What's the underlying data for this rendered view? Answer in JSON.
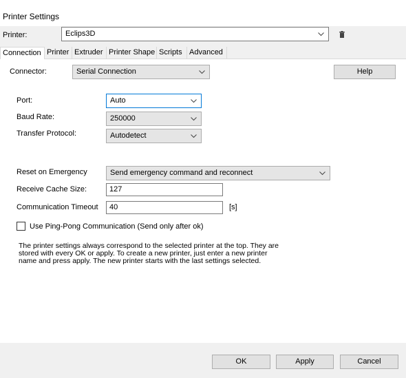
{
  "window": {
    "title": "Printer Settings"
  },
  "printer": {
    "label": "Printer:",
    "value": "Eclips3D"
  },
  "icons": {
    "delete": "trash-icon",
    "dropdown": "chevron-down-icon"
  },
  "tabs": [
    {
      "label": "Connection",
      "active": true
    },
    {
      "label": "Printer"
    },
    {
      "label": "Extruder"
    },
    {
      "label": "Printer Shape"
    },
    {
      "label": "Scripts"
    },
    {
      "label": "Advanced"
    }
  ],
  "connector": {
    "label": "Connector:",
    "value": "Serial Connection"
  },
  "help_label": "Help",
  "port": {
    "label": "Port:",
    "value": "Auto"
  },
  "baud": {
    "label": "Baud Rate:",
    "value": "250000"
  },
  "protocol": {
    "label": "Transfer Protocol:",
    "value": "Autodetect"
  },
  "reset": {
    "label": "Reset on Emergency",
    "value": "Send emergency command and reconnect"
  },
  "cache": {
    "label": "Receive Cache Size:",
    "value": "127"
  },
  "timeout": {
    "label": "Communication Timeout",
    "value": "40",
    "unit": "[s]"
  },
  "pingpong": {
    "label": "Use Ping-Pong Communication (Send only after ok)",
    "checked": false
  },
  "info_text": "The printer settings always correspond to the selected printer at the top. They are stored with every OK or apply. To create a new printer, just enter a new printer name and press apply. The new printer starts with the last settings selected.",
  "footer": {
    "ok": "OK",
    "apply": "Apply",
    "cancel": "Cancel"
  },
  "colors": {
    "focus_border": "#0078d7",
    "dialog_bg": "#f0f0f0",
    "panel_bg": "#ffffff"
  }
}
